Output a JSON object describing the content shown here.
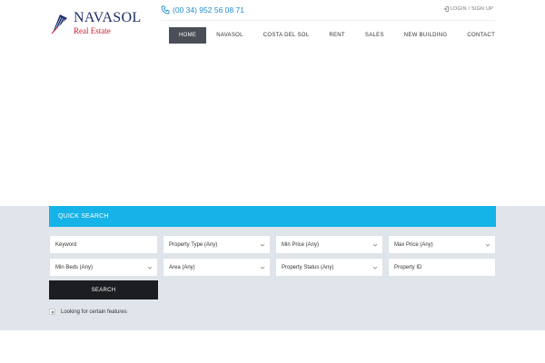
{
  "brand": {
    "name": "NAVASOL",
    "subtitle": "Real Estate",
    "logo_icon": "feather-logo-icon",
    "colors": {
      "navy": "#1c2e6b",
      "red": "#c8202f"
    }
  },
  "header": {
    "phone": "(00 34) 952 56 08 71",
    "phone_icon": "phone-icon",
    "login": "LOGIN / SIGN UP",
    "login_icon": "sign-in-icon"
  },
  "nav": {
    "items": [
      {
        "label": "HOME",
        "active": true
      },
      {
        "label": "NAVASOL",
        "active": false
      },
      {
        "label": "COSTA DEL SOL",
        "active": false
      },
      {
        "label": "RENT",
        "active": false
      },
      {
        "label": "SALES",
        "active": false
      },
      {
        "label": "NEW BUILDING",
        "active": false
      },
      {
        "label": "CONTACT",
        "active": false
      }
    ],
    "active_color": "#4a4f57"
  },
  "search": {
    "title": "QUICK SEARCH",
    "accent": "#15b3e8",
    "row1": {
      "keyword_placeholder": "Keyword",
      "property_type": "Property Type (Any)",
      "min_price": "Min Price (Any)",
      "max_price": "Max Price (Any)"
    },
    "row2": {
      "min_beds": "Min Beds (Any)",
      "area": "Area (Any)",
      "property_status": "Property Status (Any)",
      "property_id_placeholder": "Property ID"
    },
    "button": "SEARCH",
    "features_toggle": "Looking for certain features"
  }
}
